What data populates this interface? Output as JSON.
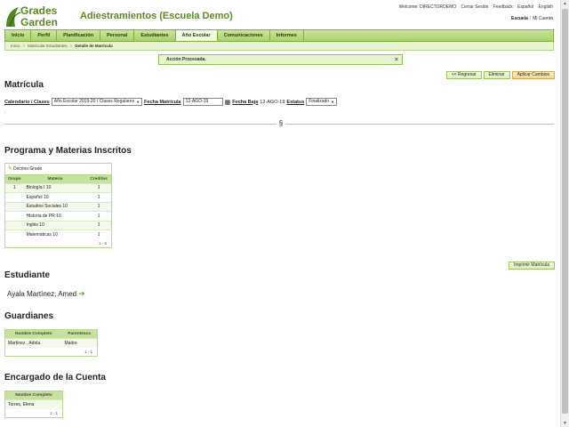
{
  "header": {
    "logo_line1": "Grades",
    "logo_line2": "Garden",
    "app_title": "Adiestramientos (Escuela Demo)",
    "toplinks": [
      "Welcome: DIRECTORDEMO",
      "Cerrar Sesión",
      "Feedback",
      "Español",
      "English"
    ],
    "school_label": "Escuela",
    "my_account": "Mi Cuenta"
  },
  "nav": {
    "tabs": [
      "Inicio",
      "Perfil",
      "Planificación",
      "Personal",
      "Estudiantes",
      "Año Escolar",
      "Comunicaciones",
      "Informes"
    ],
    "active_index": 5
  },
  "breadcrumb": {
    "items": [
      "Inicio",
      "Matricular Estudiantes"
    ],
    "current": "Detalle de Matrícula"
  },
  "message": {
    "text": "Acción Procesada.",
    "close": "×"
  },
  "actions": {
    "back": "<< Regresar",
    "delete": "Eliminar",
    "apply": "Aplicar Cambios"
  },
  "matricula": {
    "title": "Matrícula",
    "calendar_label": "Calendario / Clases",
    "calendar_value": "Año Escolar 2019-20 / Clases Regulares",
    "fecha_label": "Fecha Matrícula",
    "fecha_value": "12-AGO-19",
    "baja_label": "Fecha Baja",
    "baja_value": "12-AGO-19",
    "estatus_label": "Estatus",
    "estatus_value": "Finalizado",
    "dot": "."
  },
  "section_mark": "§",
  "programa": {
    "title": "Programa y Materias Inscritos",
    "grade": "Décimo Grado",
    "headers": [
      "Grupo",
      "Materia",
      "Creditos"
    ],
    "rows": [
      {
        "grupo": "1",
        "materia": "Biología I 10",
        "creditos": "1"
      },
      {
        "grupo": "",
        "materia": "Español 10",
        "creditos": "1"
      },
      {
        "grupo": "",
        "materia": "Estudios Sociales 10",
        "creditos": "1"
      },
      {
        "grupo": "",
        "materia": "Historia de PR 10",
        "creditos": "1"
      },
      {
        "grupo": "",
        "materia": "Inglés 10",
        "creditos": "1"
      },
      {
        "grupo": "",
        "materia": "Matemáticas 10",
        "creditos": "1"
      }
    ],
    "pager": "1 - 6"
  },
  "print_button": "Imprimir Matrícula",
  "estudiante": {
    "title": "Estudiante",
    "name": "Ayala Martínez, Amed"
  },
  "guardianes": {
    "title": "Guardianes",
    "headers": [
      "Nombre Completo",
      "Parentesco"
    ],
    "rows": [
      {
        "nombre": "Martínez , Adela",
        "parentesco": "Madre"
      }
    ],
    "pager": "1 - 1"
  },
  "encargado": {
    "title": "Encargado de la Cuenta",
    "headers": [
      "Nombre Completo"
    ],
    "rows": [
      {
        "nombre": "Torres, Elena"
      }
    ],
    "pager": "1 - 1"
  },
  "colors": {
    "brand_green": "#5a8a1e",
    "nav_green": "#a8d26a",
    "table_header": "#c5e29a"
  }
}
